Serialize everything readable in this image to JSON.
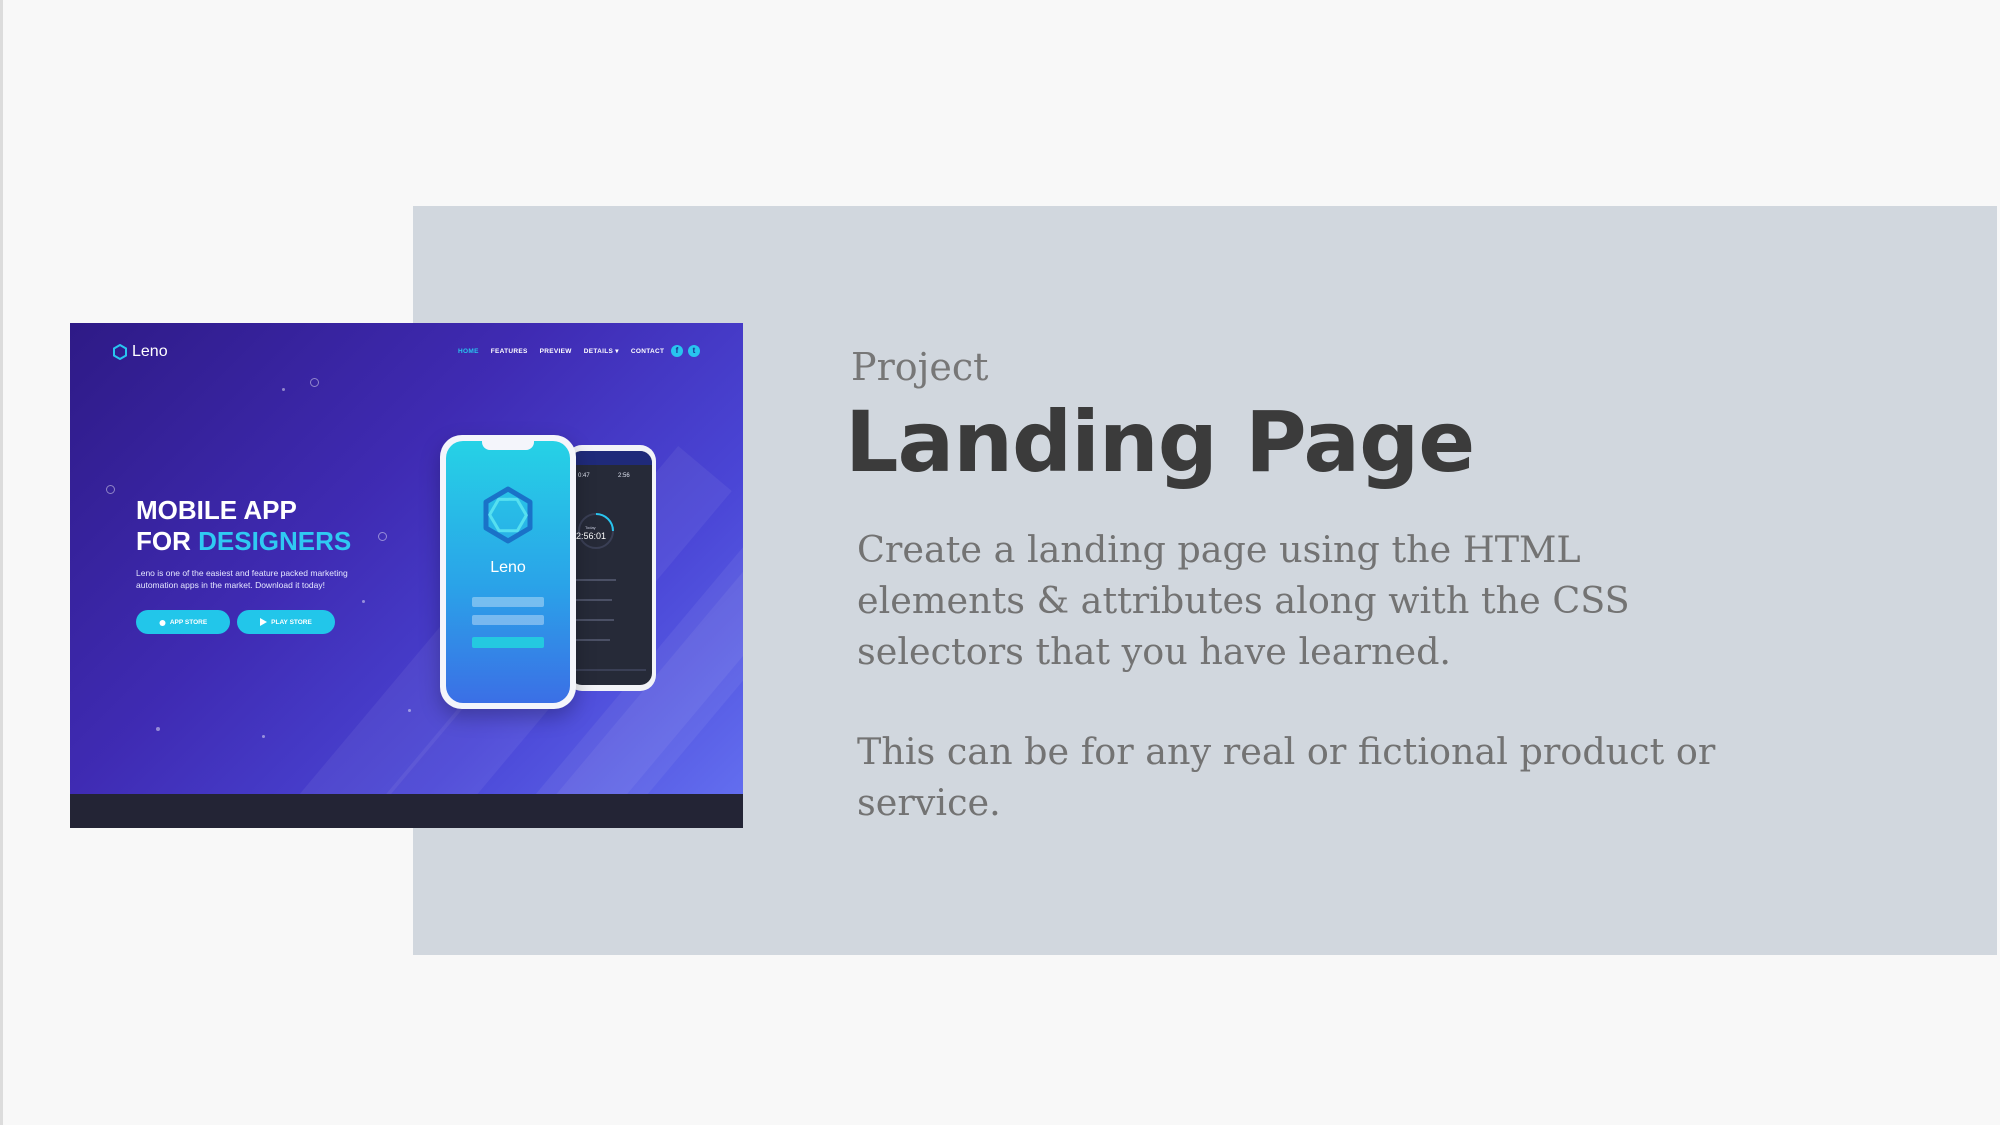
{
  "screenshot": {
    "brand": "Leno",
    "nav": [
      "HOME",
      "FEATURES",
      "PREVIEW",
      "DETAILS",
      "CONTACT"
    ],
    "nav_caret": "▾",
    "social": [
      "f",
      "t"
    ],
    "headline_line1": "MOBILE APP",
    "headline_for": "FOR ",
    "headline_accent": "DESIGNERS",
    "subtext": "Leno is one of the easiest and feature packed marketing automation apps in the market. Download it today!",
    "buttons": [
      "APP STORE",
      "PLAY STORE"
    ],
    "phone_app_name": "Leno",
    "phone_time": "2:56:01",
    "phone_stats": [
      "0:47",
      "2:56"
    ],
    "phone_today": "Today",
    "colors": {
      "accent": "#2fcaf2",
      "gradient_start": "#2e1a86",
      "gradient_end": "#6572f2",
      "footer": "#232435"
    }
  },
  "heading": {
    "kicker": "Project",
    "title": "Landing Page"
  },
  "body": {
    "paragraph1": "Create a landing page using the HTML elements & attributes along with the CSS selectors that you have learned.",
    "paragraph2": "This can be for any real or fictional product or service."
  },
  "colors": {
    "background": "#f8f8f8",
    "panel": "#d1d7de",
    "title": "#3b3b3b",
    "text": "#737373"
  }
}
